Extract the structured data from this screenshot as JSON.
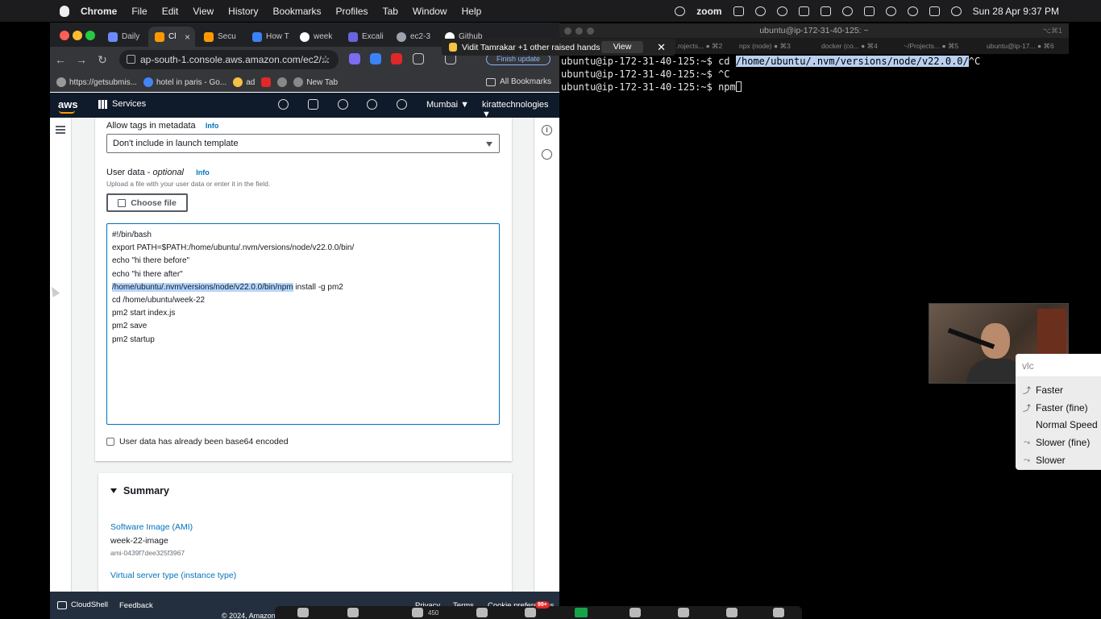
{
  "menubar": {
    "app": "Chrome",
    "items": [
      "File",
      "Edit",
      "View",
      "History",
      "Bookmarks",
      "Profiles",
      "Tab",
      "Window",
      "Help"
    ],
    "zoom_label": "zoom",
    "datetime": "Sun 28 Apr  9:37 PM"
  },
  "browser": {
    "tabs": [
      {
        "label": "Daily",
        "color": "#6b8afd"
      },
      {
        "label": "Cl",
        "color": "#ff9900"
      },
      {
        "label": "Secu",
        "color": "#ff9900"
      },
      {
        "label": "How T",
        "color": "#3b82f6"
      },
      {
        "label": "week",
        "color": "#ffffff"
      },
      {
        "label": "Excali",
        "color": "#6965db"
      },
      {
        "label": "ec2-3",
        "color": "#9ca3af"
      },
      {
        "label": "Github",
        "color": "#ffffff"
      }
    ],
    "url": "ap-south-1.console.aws.amazon.com/ec2/...",
    "update_label": "Finish update",
    "bookmarks": [
      {
        "label": "https://getsubmis...",
        "color": "#999999"
      },
      {
        "label": "hotel in paris - Go...",
        "color": "#4285f4"
      },
      {
        "label": "ad",
        "color": "#f5c342"
      },
      {
        "label": "",
        "color": "#e02828"
      },
      {
        "label": "",
        "color": "#888888"
      },
      {
        "label": "New Tab",
        "color": "#888888"
      }
    ],
    "all_bookmarks": "All Bookmarks"
  },
  "aws": {
    "logo": "aws",
    "services": "Services",
    "region": "Mumbai ▼",
    "account": "kirattechnologies ▼",
    "metadata_tags_label": "Allow tags in metadata",
    "info": "Info",
    "metadata_tags_value": "Don't include in launch template",
    "user_data_label": "User data - ",
    "user_data_optional": "optional",
    "user_data_hint": "Upload a file with your user data or enter it in the field.",
    "choose_file": "Choose file",
    "script_lines": [
      "#!/bin/bash",
      "export PATH=$PATH:/home/ubuntu/.nvm/versions/node/v22.0.0/bin/",
      "echo \"hi there before\"",
      "echo \"hi there after\"",
      "HL",
      "cd /home/ubuntu/week-22",
      "pm2 start index.js",
      "pm2 save",
      "pm2 startup"
    ],
    "script_highlight": "/home/ubuntu/.nvm/versions/node/v22.0.0/bin/npm",
    "script_highlight_rest": " install -g pm2",
    "base64_label": "User data has already been base64 encoded",
    "summary_title": "Summary",
    "ami_label": "Software Image (AMI)",
    "ami_name": "week-22-image",
    "ami_id": "ami-0439f7dee325f3967",
    "instance_type_label": "Virtual server type (instance type)",
    "footer": {
      "cloudshell": "CloudShell",
      "feedback": "Feedback",
      "privacy": "Privacy",
      "terms": "Terms",
      "cookie": "Cookie preferences",
      "copyright": "© 2024, Amazon"
    }
  },
  "terminal": {
    "title": "ubuntu@ip-172-31-40-125: ~",
    "shortcut": "⌥⌘1",
    "tabs": [
      {
        "label": "...rojects... ● ⌘2"
      },
      {
        "label": "npx (node) ● ⌘3"
      },
      {
        "label": "docker (co... ● ⌘4"
      },
      {
        "label": "~/Projects... ● ⌘5"
      },
      {
        "label": "ubuntu@ip-17... ● ⌘6"
      }
    ],
    "prompt": "ubuntu@ip-172-31-40-125:~$ ",
    "line1_cmd": "cd ",
    "line1_sel": "/home/ubuntu/.nvm/versions/node/v22.0.0/",
    "line1_tail": "^C",
    "line2_cmd": "^C",
    "line3_cmd": "npm"
  },
  "zoom_overlay": {
    "raised_hands": "Vidit Tamrakar +1 other raised hands",
    "view": "View",
    "participants": "450",
    "badge": "99+"
  },
  "vlc_menu": {
    "search": "vlc",
    "items": [
      "Faster",
      "Faster (fine)",
      "Normal Speed",
      "Slower (fine)",
      "Slower"
    ]
  }
}
